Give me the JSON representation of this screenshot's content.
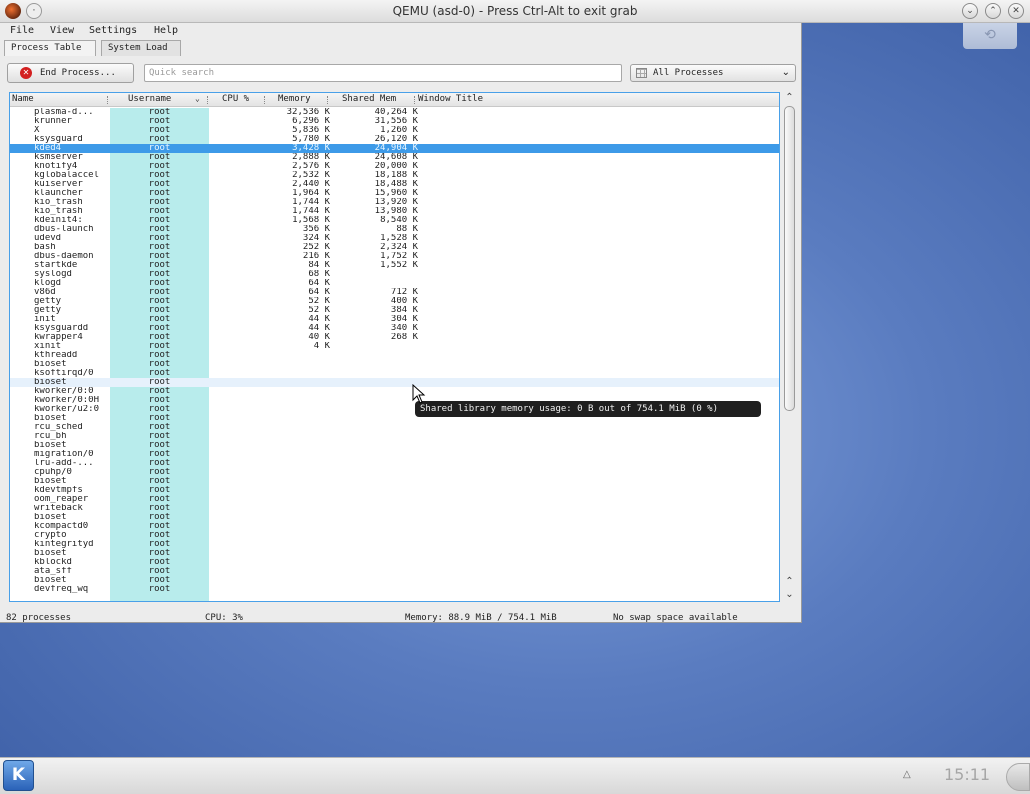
{
  "qemu": {
    "title": "QEMU (asd-0) - Press Ctrl-Alt to exit grab",
    "btn_minimize": "⌄",
    "btn_maximize": "⌃",
    "btn_close": "✕"
  },
  "menu": {
    "file": "File",
    "view": "View",
    "settings": "Settings",
    "help": "Help"
  },
  "tabs": {
    "process_table": "Process Table",
    "system_load": "System Load"
  },
  "toolbar": {
    "end_process": "End Process...",
    "search_placeholder": "Quick search",
    "filter": "All Processes"
  },
  "columns": {
    "name": "Name",
    "username": "Username",
    "cpu": "CPU %",
    "memory": "Memory",
    "shared": "Shared Mem",
    "window_title": "Window Title"
  },
  "processes": [
    {
      "name": "plasma-d...",
      "user": "root",
      "mem": "32,536 K",
      "shr": "40,264 K"
    },
    {
      "name": "krunner",
      "user": "root",
      "mem": "6,296 K",
      "shr": "31,556 K"
    },
    {
      "name": "X",
      "user": "root",
      "mem": "5,836 K",
      "shr": "1,260 K"
    },
    {
      "name": "ksysguard",
      "user": "root",
      "mem": "5,780 K",
      "shr": "26,120 K"
    },
    {
      "name": "kded4",
      "user": "root",
      "mem": "3,428 K",
      "shr": "24,904 K"
    },
    {
      "name": "ksmserver",
      "user": "root",
      "mem": "2,888 K",
      "shr": "24,608 K"
    },
    {
      "name": "knotify4",
      "user": "root",
      "mem": "2,576 K",
      "shr": "20,000 K"
    },
    {
      "name": "kglobalaccel",
      "user": "root",
      "mem": "2,532 K",
      "shr": "18,188 K"
    },
    {
      "name": "kuiserver",
      "user": "root",
      "mem": "2,440 K",
      "shr": "18,488 K"
    },
    {
      "name": "klauncher",
      "user": "root",
      "mem": "1,964 K",
      "shr": "15,960 K"
    },
    {
      "name": "kio_trash",
      "user": "root",
      "mem": "1,744 K",
      "shr": "13,920 K"
    },
    {
      "name": "kio_trash",
      "user": "root",
      "mem": "1,744 K",
      "shr": "13,980 K"
    },
    {
      "name": "kdeinit4:",
      "user": "root",
      "mem": "1,568 K",
      "shr": "8,540 K"
    },
    {
      "name": "dbus-launch",
      "user": "root",
      "mem": "356 K",
      "shr": "88 K"
    },
    {
      "name": "udevd",
      "user": "root",
      "mem": "324 K",
      "shr": "1,528 K"
    },
    {
      "name": "bash",
      "user": "root",
      "mem": "252 K",
      "shr": "2,324 K"
    },
    {
      "name": "dbus-daemon",
      "user": "root",
      "mem": "216 K",
      "shr": "1,752 K"
    },
    {
      "name": "startkde",
      "user": "root",
      "mem": "84 K",
      "shr": "1,552 K"
    },
    {
      "name": "syslogd",
      "user": "root",
      "mem": "68 K",
      "shr": ""
    },
    {
      "name": "klogd",
      "user": "root",
      "mem": "64 K",
      "shr": ""
    },
    {
      "name": "v86d",
      "user": "root",
      "mem": "64 K",
      "shr": "712 K"
    },
    {
      "name": "getty",
      "user": "root",
      "mem": "52 K",
      "shr": "400 K"
    },
    {
      "name": "getty",
      "user": "root",
      "mem": "52 K",
      "shr": "384 K"
    },
    {
      "name": "init",
      "user": "root",
      "mem": "44 K",
      "shr": "304 K"
    },
    {
      "name": "ksysguardd",
      "user": "root",
      "mem": "44 K",
      "shr": "340 K"
    },
    {
      "name": "kwrapper4",
      "user": "root",
      "mem": "40 K",
      "shr": "268 K"
    },
    {
      "name": "xinit",
      "user": "root",
      "mem": "4 K",
      "shr": ""
    },
    {
      "name": "kthreadd",
      "user": "root",
      "mem": "",
      "shr": ""
    },
    {
      "name": "bioset",
      "user": "root",
      "mem": "",
      "shr": ""
    },
    {
      "name": "ksoftirqd/0",
      "user": "root",
      "mem": "",
      "shr": ""
    },
    {
      "name": "bioset",
      "user": "root",
      "mem": "",
      "shr": ""
    },
    {
      "name": "kworker/0:0",
      "user": "root",
      "mem": "",
      "shr": ""
    },
    {
      "name": "kworker/0:0H",
      "user": "root",
      "mem": "",
      "shr": ""
    },
    {
      "name": "kworker/u2:0",
      "user": "root",
      "mem": "",
      "shr": ""
    },
    {
      "name": "bioset",
      "user": "root",
      "mem": "",
      "shr": ""
    },
    {
      "name": "rcu_sched",
      "user": "root",
      "mem": "",
      "shr": ""
    },
    {
      "name": "rcu_bh",
      "user": "root",
      "mem": "",
      "shr": ""
    },
    {
      "name": "bioset",
      "user": "root",
      "mem": "",
      "shr": ""
    },
    {
      "name": "migration/0",
      "user": "root",
      "mem": "",
      "shr": ""
    },
    {
      "name": "lru-add-...",
      "user": "root",
      "mem": "",
      "shr": ""
    },
    {
      "name": "cpuhp/0",
      "user": "root",
      "mem": "",
      "shr": ""
    },
    {
      "name": "bioset",
      "user": "root",
      "mem": "",
      "shr": ""
    },
    {
      "name": "kdevtmpfs",
      "user": "root",
      "mem": "",
      "shr": ""
    },
    {
      "name": "oom_reaper",
      "user": "root",
      "mem": "",
      "shr": ""
    },
    {
      "name": "writeback",
      "user": "root",
      "mem": "",
      "shr": ""
    },
    {
      "name": "bioset",
      "user": "root",
      "mem": "",
      "shr": ""
    },
    {
      "name": "kcompactd0",
      "user": "root",
      "mem": "",
      "shr": ""
    },
    {
      "name": "crypto",
      "user": "root",
      "mem": "",
      "shr": ""
    },
    {
      "name": "kintegrityd",
      "user": "root",
      "mem": "",
      "shr": ""
    },
    {
      "name": "bioset",
      "user": "root",
      "mem": "",
      "shr": ""
    },
    {
      "name": "kblockd",
      "user": "root",
      "mem": "",
      "shr": ""
    },
    {
      "name": "ata_sff",
      "user": "root",
      "mem": "",
      "shr": ""
    },
    {
      "name": "bioset",
      "user": "root",
      "mem": "",
      "shr": ""
    },
    {
      "name": "devfreq_wq",
      "user": "root",
      "mem": "",
      "shr": ""
    }
  ],
  "selected_row": 4,
  "hovered_row": 30,
  "tooltip": "Shared library memory usage: 0 B out of 754.1 MiB  (0 %)",
  "status": {
    "processes": "82 processes",
    "cpu": "CPU: 3%",
    "memory": "Memory: 88.9 MiB / 754.1 MiB",
    "swap": "No swap space available"
  },
  "panel": {
    "clock": "15:11",
    "kmenu": "K"
  },
  "colors": {
    "selection": "#3d9ae8",
    "username_column": "#b8ecec",
    "table_border": "#49a0e8",
    "tooltip_bg": "#1f1f1f"
  }
}
